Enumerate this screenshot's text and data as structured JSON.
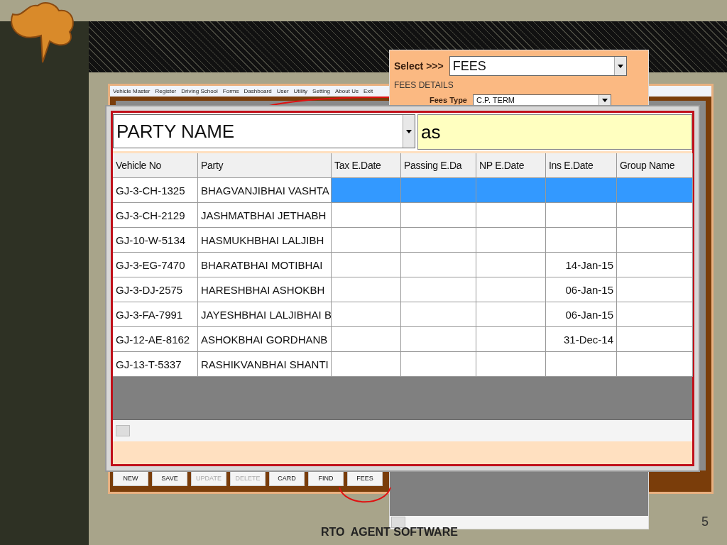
{
  "slide": {
    "footer": "RTO  AGENT SOFTWARE",
    "page_number": "5"
  },
  "main_window": {
    "menu": [
      "Vehicle Master",
      "Register",
      "Driving School",
      "Forms",
      "Dashboard",
      "User",
      "Utility",
      "Setting",
      "About Us",
      "Exit"
    ],
    "buttons": [
      {
        "label": "NEW",
        "disabled": false
      },
      {
        "label": "SAVE",
        "disabled": false
      },
      {
        "label": "UPDATE",
        "disabled": true
      },
      {
        "label": "DELETE",
        "disabled": true
      },
      {
        "label": "CARD",
        "disabled": false
      },
      {
        "label": "FIND",
        "disabled": false
      },
      {
        "label": "FEES",
        "disabled": false
      }
    ]
  },
  "fees_panel": {
    "select_label": "Select >>>",
    "select_value": "FEES",
    "group_title": "FEES DETAILS",
    "fees_type_label": "Fees Type",
    "fees_type_value": "C.P. TERM"
  },
  "search_window": {
    "field": "PARTY NAME",
    "query": "as",
    "columns": [
      "Vehicle No",
      "Party",
      "Tax E.Date",
      "Passing E.Da",
      "NP E.Date",
      "Ins E.Date",
      "Group Name"
    ],
    "rows": [
      {
        "selected": true,
        "cells": [
          "GJ-3-CH-1325",
          "BHAGVANJIBHAI VASHTA",
          "",
          "",
          "",
          "",
          ""
        ]
      },
      {
        "selected": false,
        "cells": [
          "GJ-3-CH-2129",
          "JASHMATBHAI JETHABH",
          "",
          "",
          "",
          "",
          ""
        ]
      },
      {
        "selected": false,
        "cells": [
          "GJ-10-W-5134",
          "HASMUKHBHAI LALJIBH",
          "",
          "",
          "",
          "",
          ""
        ]
      },
      {
        "selected": false,
        "cells": [
          "GJ-3-EG-7470",
          "BHARATBHAI MOTIBHAI",
          "",
          "",
          "",
          "14-Jan-15",
          ""
        ]
      },
      {
        "selected": false,
        "cells": [
          "GJ-3-DJ-2575",
          "HARESHBHAI ASHOKBH",
          "",
          "",
          "",
          "06-Jan-15",
          ""
        ]
      },
      {
        "selected": false,
        "cells": [
          "GJ-3-FA-7991",
          "JAYESHBHAI LALJIBHAI B",
          "",
          "",
          "",
          "06-Jan-15",
          ""
        ]
      },
      {
        "selected": false,
        "cells": [
          "GJ-12-AE-8162",
          "ASHOKBHAI GORDHANB",
          "",
          "",
          "",
          "31-Dec-14",
          ""
        ]
      },
      {
        "selected": false,
        "cells": [
          "GJ-13-T-5337",
          "RASHIKVANBHAI SHANTI",
          "",
          "",
          "",
          "",
          ""
        ]
      }
    ]
  }
}
